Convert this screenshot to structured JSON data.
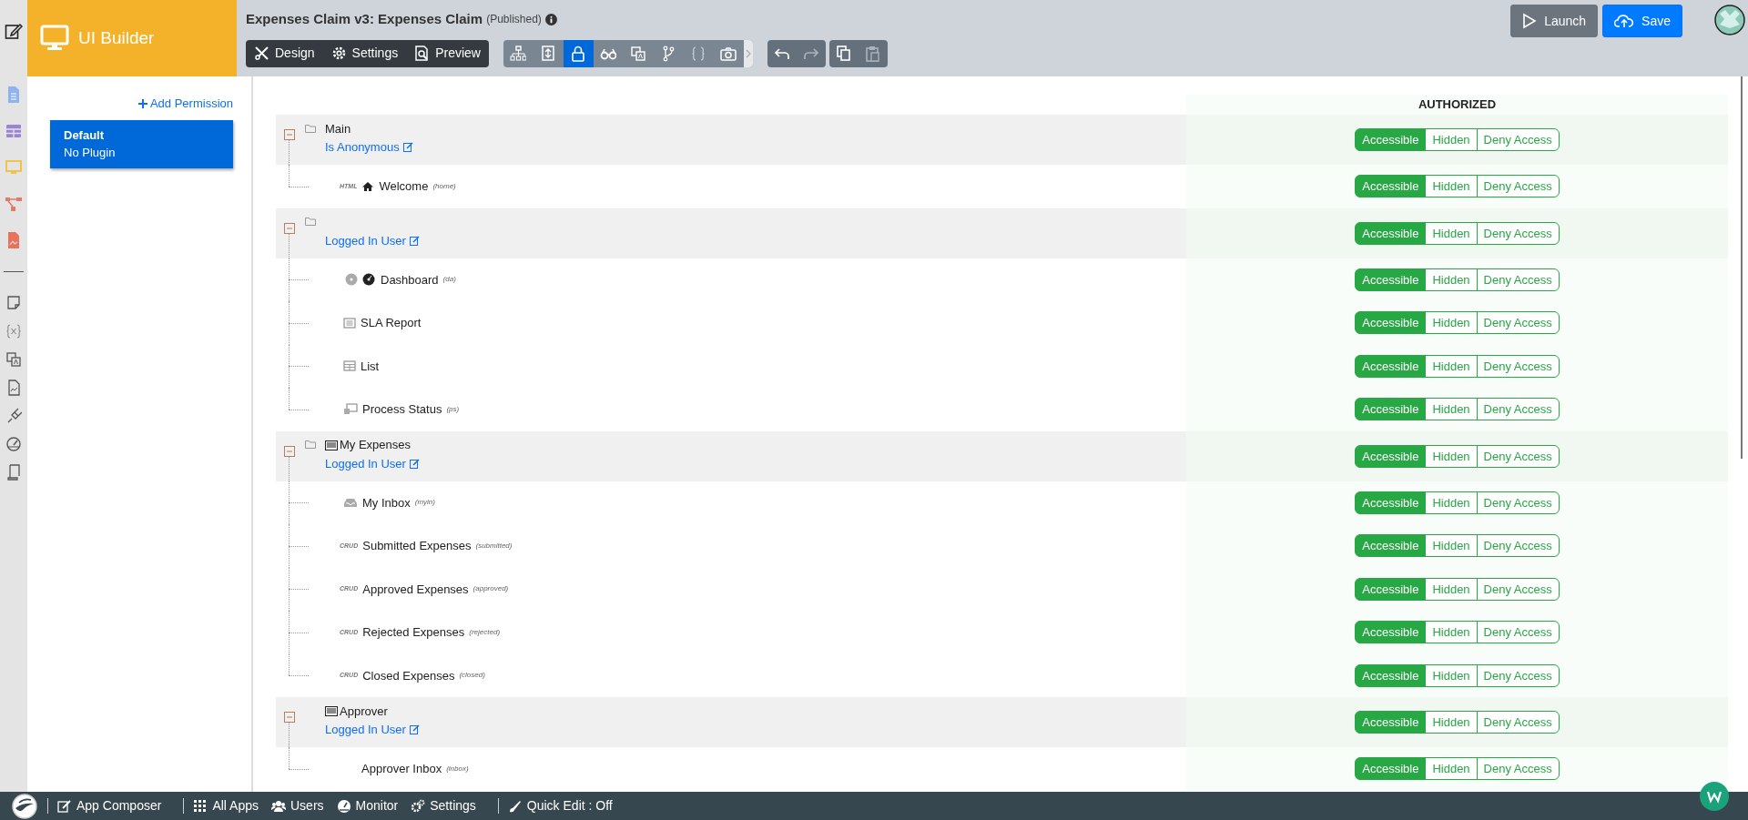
{
  "module": {
    "title": "UI Builder"
  },
  "header": {
    "title": "Expenses Claim v3: Expenses Claim",
    "status": "(Published)"
  },
  "mode_buttons": [
    {
      "label": "Design"
    },
    {
      "label": "Settings"
    },
    {
      "label": "Preview"
    }
  ],
  "tool_icons": [
    {
      "selected": false
    },
    {
      "selected": false
    },
    {
      "selected": true
    },
    {
      "selected": false
    },
    {
      "selected": false
    },
    {
      "selected": false
    },
    {
      "selected": false
    },
    {
      "selected": false
    }
  ],
  "actions": [
    {
      "label": "Launch"
    },
    {
      "label": "Save"
    }
  ],
  "permissions_panel": {
    "add_link": "Add Permission",
    "items": [
      {
        "title": "Default",
        "subtitle": "No Plugin",
        "selected": true
      }
    ]
  },
  "table": {
    "column": "AUTHORIZED",
    "rows": [
      {
        "title": "Main",
        "folder": true,
        "card_icon": false,
        "condition": "Is Anonymous",
        "expanded": true,
        "access": [
          {
            "label": "Accessible",
            "selected": true
          },
          {
            "label": "Hidden",
            "selected": false
          },
          {
            "label": "Deny Access",
            "selected": false
          }
        ],
        "children": [
          {
            "kind": "html",
            "tag": "HTML",
            "label": "Welcome",
            "code": "(home)",
            "access": [
              {
                "label": "Accessible",
                "selected": true
              },
              {
                "label": "Hidden",
                "selected": false
              },
              {
                "label": "Deny Access",
                "selected": false
              }
            ]
          }
        ]
      },
      {
        "title": "",
        "folder": true,
        "card_icon": false,
        "condition": "Logged In User",
        "expanded": true,
        "access": [
          {
            "label": "Accessible",
            "selected": true
          },
          {
            "label": "Hidden",
            "selected": false
          },
          {
            "label": "Deny Access",
            "selected": false
          }
        ],
        "children": [
          {
            "kind": "dashboard",
            "label": "Dashboard",
            "code": "(da)",
            "access": [
              {
                "label": "Accessible",
                "selected": true
              },
              {
                "label": "Hidden",
                "selected": false
              },
              {
                "label": "Deny Access",
                "selected": false
              }
            ]
          },
          {
            "kind": "report",
            "label": "SLA Report",
            "access": [
              {
                "label": "Accessible",
                "selected": true
              },
              {
                "label": "Hidden",
                "selected": false
              },
              {
                "label": "Deny Access",
                "selected": false
              }
            ]
          },
          {
            "kind": "list",
            "label": "List",
            "access": [
              {
                "label": "Accessible",
                "selected": true
              },
              {
                "label": "Hidden",
                "selected": false
              },
              {
                "label": "Deny Access",
                "selected": false
              }
            ]
          },
          {
            "kind": "process",
            "label": "Process Status",
            "code": "(ps)",
            "access": [
              {
                "label": "Accessible",
                "selected": true
              },
              {
                "label": "Hidden",
                "selected": false
              },
              {
                "label": "Deny Access",
                "selected": false
              }
            ]
          }
        ]
      },
      {
        "title": "My Expenses",
        "folder": true,
        "card_icon": true,
        "condition": "Logged In User",
        "expanded": true,
        "access": [
          {
            "label": "Accessible",
            "selected": true
          },
          {
            "label": "Hidden",
            "selected": false
          },
          {
            "label": "Deny Access",
            "selected": false
          }
        ],
        "children": [
          {
            "kind": "inbox",
            "label": "My Inbox",
            "code": "(myin)",
            "access": [
              {
                "label": "Accessible",
                "selected": true
              },
              {
                "label": "Hidden",
                "selected": false
              },
              {
                "label": "Deny Access",
                "selected": false
              }
            ]
          },
          {
            "kind": "crud",
            "tag": "CRUD",
            "label": "Submitted Expenses",
            "code": "(submitted)",
            "access": [
              {
                "label": "Accessible",
                "selected": true
              },
              {
                "label": "Hidden",
                "selected": false
              },
              {
                "label": "Deny Access",
                "selected": false
              }
            ]
          },
          {
            "kind": "crud",
            "tag": "CRUD",
            "label": "Approved Expenses",
            "code": "(approved)",
            "access": [
              {
                "label": "Accessible",
                "selected": true
              },
              {
                "label": "Hidden",
                "selected": false
              },
              {
                "label": "Deny Access",
                "selected": false
              }
            ]
          },
          {
            "kind": "crud",
            "tag": "CRUD",
            "label": "Rejected Expenses",
            "code": "(rejected)",
            "access": [
              {
                "label": "Accessible",
                "selected": true
              },
              {
                "label": "Hidden",
                "selected": false
              },
              {
                "label": "Deny Access",
                "selected": false
              }
            ]
          },
          {
            "kind": "crud",
            "tag": "CRUD",
            "label": "Closed Expenses",
            "code": "(closed)",
            "access": [
              {
                "label": "Accessible",
                "selected": true
              },
              {
                "label": "Hidden",
                "selected": false
              },
              {
                "label": "Deny Access",
                "selected": false
              }
            ]
          }
        ]
      },
      {
        "title": "Approver",
        "folder": false,
        "card_icon": true,
        "condition": "Logged In User",
        "expanded": true,
        "access": [
          {
            "label": "Accessible",
            "selected": true
          },
          {
            "label": "Hidden",
            "selected": false
          },
          {
            "label": "Deny Access",
            "selected": false
          }
        ],
        "children": [
          {
            "kind": "plain",
            "label": "Approver Inbox",
            "code": "(inbox)",
            "access": [
              {
                "label": "Accessible",
                "selected": true
              },
              {
                "label": "Hidden",
                "selected": false
              },
              {
                "label": "Deny Access",
                "selected": false
              }
            ]
          }
        ]
      }
    ]
  },
  "footer": [
    {
      "label": "App Composer"
    },
    {
      "label": "All Apps"
    },
    {
      "label": "Users"
    },
    {
      "label": "Monitor"
    },
    {
      "label": "Settings"
    },
    {
      "label": "Quick Edit : Off"
    }
  ]
}
